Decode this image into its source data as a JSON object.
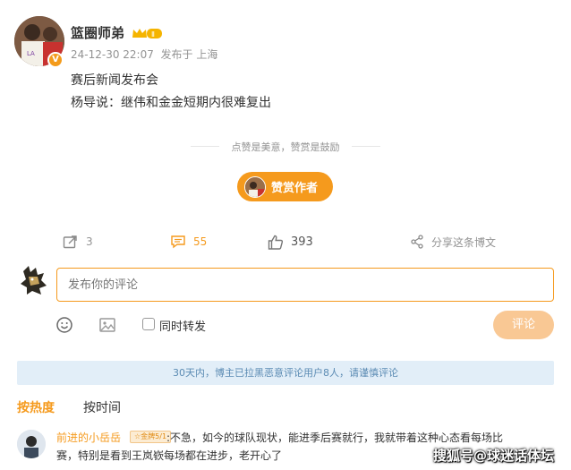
{
  "post": {
    "username": "篮圈师弟",
    "timestamp": "24-12-30 22:07",
    "location": "发布于 上海",
    "line1": "赛后新闻发布会",
    "line2": "杨导说：继伟和金金短期内很难复出"
  },
  "reward": {
    "divider_text": "点赞是美意，赞赏是鼓励",
    "button_label": "赞赏作者"
  },
  "actions": {
    "repost_count": "3",
    "comment_count": "55",
    "like_count": "393",
    "share_label": "分享这条博文"
  },
  "composer": {
    "placeholder": "发布你的评论",
    "repost_label": "同时转发",
    "submit_label": "评论"
  },
  "notice": "30天内，博主已拉黑恶意评论用户8人，请谨慎评论",
  "sort_tabs": {
    "hot": "按热度",
    "time": "按时间"
  },
  "comment": {
    "user": "前进的小岳岳",
    "badge": "☆金牌5/1",
    "line1": ":不急，如今的球队现状，能进季后赛就行，我就带着这种心态看每场比",
    "line2": "赛，特别是看到王岚嵚每场都在进步，老开心了"
  },
  "watermark": "搜狐号@球迷话体坛",
  "colors": {
    "accent": "#f59a1d",
    "notice_bg": "#e2eef8",
    "notice_text": "#5b8bb3"
  }
}
